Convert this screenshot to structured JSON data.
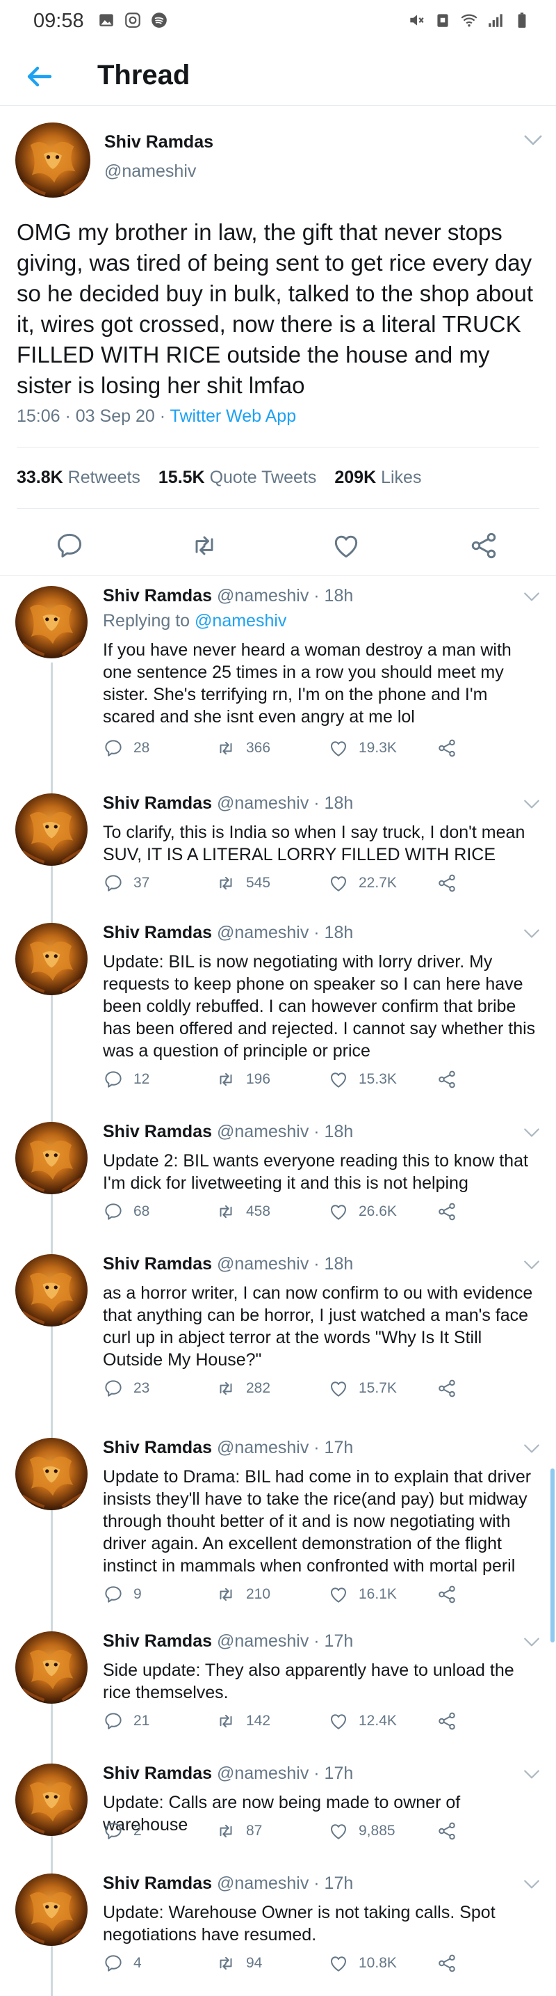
{
  "status_bar": {
    "time": "09:58"
  },
  "header": {
    "title": "Thread"
  },
  "main_tweet": {
    "name": "Shiv Ramdas",
    "handle": "@nameshiv",
    "text": "OMG my brother in law, the gift that never stops giving, was tired of being sent to get rice every day so he decided buy in bulk, talked to the shop about it, wires got crossed, now there is a literal TRUCK FILLED WITH RICE outside the house and my sister is losing her shit lmfao",
    "time": "15:06 · 03 Sep 20 · ",
    "source": "Twitter Web App",
    "retweets": "33.8K",
    "retweets_label": "Retweets",
    "quotes": "15.5K",
    "quotes_label": "Quote Tweets",
    "likes": "209K",
    "likes_label": "Likes"
  },
  "replies": [
    {
      "name": "Shiv Ramdas",
      "handle": "@nameshiv · 18h",
      "replying_prefix": "Replying to ",
      "replying_to": "@nameshiv",
      "text": "If you have never heard a woman destroy a man with one sentence 25 times in a row you should meet my sister. She's terrifying rn, I'm on the phone and I'm scared and she isnt even angry at me lol",
      "replies": "28",
      "retweets": "366",
      "likes": "19.3K"
    },
    {
      "name": "Shiv Ramdas",
      "handle": "@nameshiv · 18h",
      "text": "To clarify, this is India so when I say truck, I don't mean SUV, IT IS A LITERAL LORRY FILLED WITH RICE",
      "replies": "37",
      "retweets": "545",
      "likes": "22.7K"
    },
    {
      "name": "Shiv Ramdas",
      "handle": "@nameshiv · 18h",
      "text": "Update: BIL is now negotiating with lorry driver. My requests to keep phone on speaker so I can here have been coldly rebuffed. I can however confirm that bribe has been offered and rejected. I cannot say whether this was a question of principle or price",
      "replies": "12",
      "retweets": "196",
      "likes": "15.3K"
    },
    {
      "name": "Shiv Ramdas",
      "handle": "@nameshiv · 18h",
      "text": "Update 2: BIL wants everyone reading this to know that I'm  dick for livetweeting it and this is not helping",
      "replies": "68",
      "retweets": "458",
      "likes": "26.6K"
    },
    {
      "name": "Shiv Ramdas",
      "handle": "@nameshiv · 18h",
      "text": "as a horror writer, I can now confirm to ou with evidence that anything can be horror, I just watched a man's face curl up in abject terror at the words \"Why Is It Still Outside My House?\"",
      "replies": "23",
      "retweets": "282",
      "likes": "15.7K"
    },
    {
      "name": "Shiv Ramdas",
      "handle": "@nameshiv · 17h",
      "text": "Update to Drama: BIL had come in to explain that driver insists they'll have to take the rice(and pay) but midway through thouht better of it and is now negotiating with driver again. An excellent demonstration of the flight instinct in mammals when confronted with mortal peril",
      "replies": "9",
      "retweets": "210",
      "likes": "16.1K"
    },
    {
      "name": "Shiv Ramdas",
      "handle": "@nameshiv · 17h",
      "text": "Side update: They also apparently have to unload the rice themselves.",
      "replies": "21",
      "retweets": "142",
      "likes": "12.4K"
    },
    {
      "name": "Shiv Ramdas",
      "handle": "@nameshiv · 17h",
      "text": "Update: Calls are now being made to owner of warehouse",
      "replies": "2",
      "retweets": "87",
      "likes": "9,885"
    },
    {
      "name": "Shiv Ramdas",
      "handle": "@nameshiv · 17h",
      "text": "Update: Warehouse Owner is not taking calls. Spot negotiations have resumed.",
      "replies": "4",
      "retweets": "94",
      "likes": "10.8K"
    }
  ],
  "colors": {
    "accent": "#1da1f2",
    "secondary_text": "#657786",
    "text": "#14171a"
  }
}
